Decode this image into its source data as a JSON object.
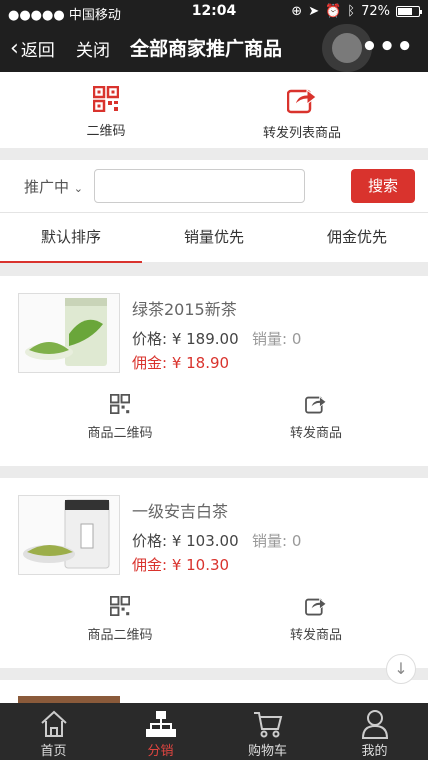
{
  "status_bar": {
    "carrier": "●●●●● 中国移动",
    "time": "12:04",
    "battery": "72%",
    "battery_level": 0.72
  },
  "nav": {
    "back_label": "返回",
    "close_label": "关闭",
    "title": "全部商家推广商品",
    "more_label": "•••"
  },
  "share_bar": {
    "qr_label": "二维码",
    "forward_label": "转发列表商品"
  },
  "search": {
    "status_label": "推广中",
    "input_value": "",
    "input_placeholder": "",
    "button_label": "搜索"
  },
  "sort_tabs": [
    {
      "label": "默认排序",
      "active": true
    },
    {
      "label": "销量优先",
      "active": false
    },
    {
      "label": "佣金优先",
      "active": false
    }
  ],
  "products": [
    {
      "name": "绿茶2015新茶",
      "price": "价格: ¥ 189.00",
      "sales": "销量: 0",
      "commission": "佣金: ¥ 18.90",
      "qr_action": "商品二维码",
      "forward_action": "转发商品"
    },
    {
      "name": "一级安吉白茶",
      "price": "价格: ¥ 103.00",
      "sales": "销量: 0",
      "commission": "佣金: ¥ 10.30",
      "qr_action": "商品二维码",
      "forward_action": "转发商品"
    }
  ],
  "bottom_tabs": [
    {
      "label": "首页",
      "icon": "home-icon",
      "active": false
    },
    {
      "label": "分销",
      "icon": "distribution-icon",
      "active": true
    },
    {
      "label": "购物车",
      "icon": "cart-icon",
      "active": false
    },
    {
      "label": "我的",
      "icon": "user-icon",
      "active": false
    }
  ],
  "colors": {
    "accent": "#d9332d",
    "nav_bg": "#1f1f1f",
    "tabbar_bg": "#2a2a2a"
  }
}
